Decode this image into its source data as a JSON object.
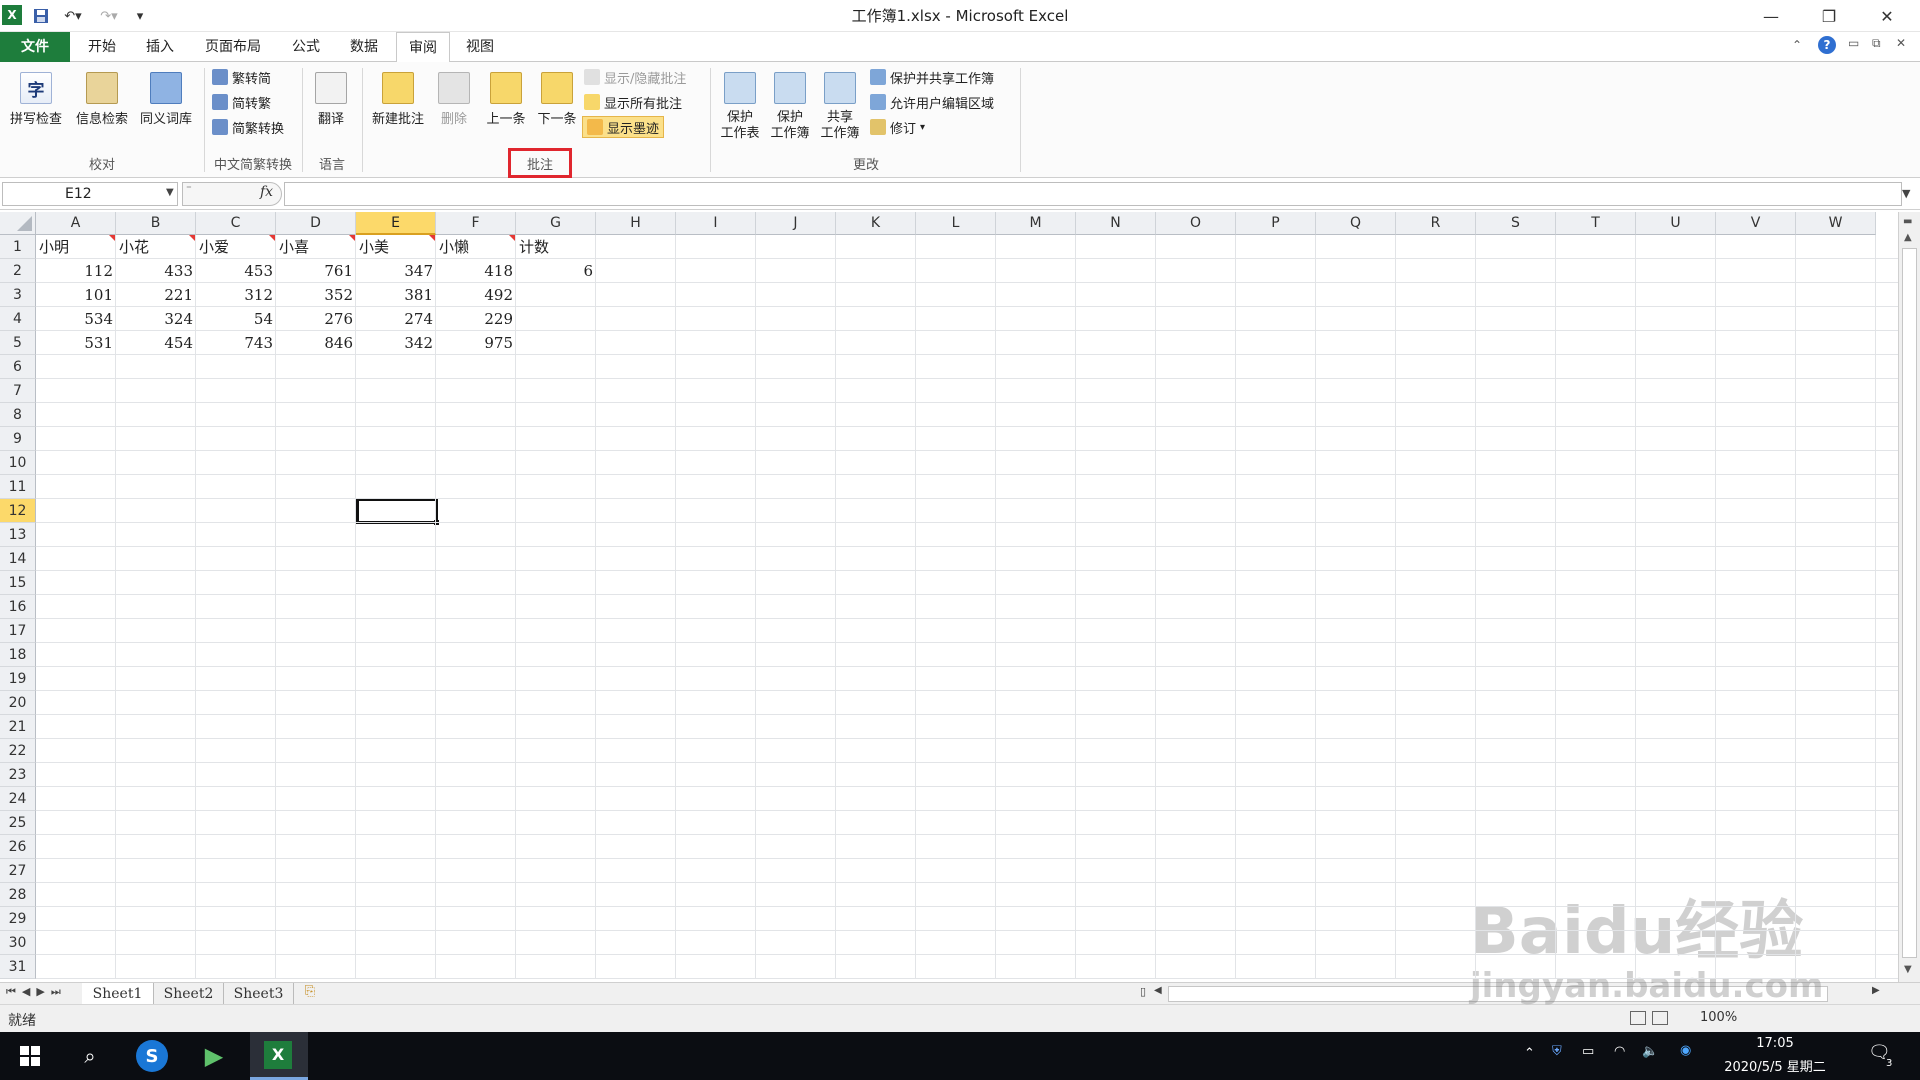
{
  "window": {
    "title": "工作簿1.xlsx - Microsoft Excel"
  },
  "quick_access": {
    "dropdown": "▾"
  },
  "tabs": [
    {
      "label": "文件"
    },
    {
      "label": "开始"
    },
    {
      "label": "插入"
    },
    {
      "label": "页面布局"
    },
    {
      "label": "公式"
    },
    {
      "label": "数据"
    },
    {
      "label": "审阅"
    },
    {
      "label": "视图"
    }
  ],
  "ribbon": {
    "proofing": {
      "spell": "拼写检查",
      "research": "信息检索",
      "thesaurus": "同义词库",
      "group": "校对"
    },
    "chinese": {
      "t2s": "繁转简",
      "s2t": "简转繁",
      "convert": "简繁转换",
      "group": "中文简繁转换"
    },
    "language": {
      "translate": "翻译",
      "group": "语言"
    },
    "comments": {
      "new": "新建批注",
      "delete": "删除",
      "prev": "上一条",
      "next": "下一条",
      "show_hide": "显示/隐藏批注",
      "show_all": "显示所有批注",
      "show_ink": "显示墨迹",
      "group": "批注"
    },
    "changes": {
      "protect_sheet_1": "保护",
      "protect_sheet_2": "工作表",
      "protect_book_1": "保护",
      "protect_book_2": "工作簿",
      "share_book_1": "共享",
      "share_book_2": "工作簿",
      "protect_share": "保护并共享工作簿",
      "allow_edit": "允许用户编辑区域",
      "track": "修订",
      "group": "更改"
    }
  },
  "formula_bar": {
    "name_box": "E12",
    "fx": "fx",
    "content": ""
  },
  "grid": {
    "columns": [
      "A",
      "B",
      "C",
      "D",
      "E",
      "F",
      "G",
      "H",
      "I",
      "J",
      "K",
      "L",
      "M",
      "N",
      "O",
      "P",
      "Q",
      "R",
      "S",
      "T",
      "U",
      "V",
      "W"
    ],
    "selected_column": "E",
    "rows": [
      "1",
      "2",
      "3",
      "4",
      "5",
      "6",
      "7",
      "8",
      "9",
      "10",
      "11",
      "12",
      "13",
      "14",
      "15",
      "16",
      "17",
      "18",
      "19",
      "20",
      "21",
      "22",
      "23",
      "24",
      "25",
      "26",
      "27",
      "28",
      "29",
      "30",
      "31"
    ],
    "selected_row": "12",
    "headers": [
      "小明",
      "小花",
      "小爱",
      "小喜",
      "小美",
      "小懒",
      "计数"
    ],
    "data": [
      [
        "112",
        "433",
        "453",
        "761",
        "347",
        "418",
        "6"
      ],
      [
        "101",
        "221",
        "312",
        "352",
        "381",
        "492",
        ""
      ],
      [
        "534",
        "324",
        "54",
        "276",
        "274",
        "229",
        ""
      ],
      [
        "531",
        "454",
        "743",
        "846",
        "342",
        "975",
        ""
      ]
    ]
  },
  "sheets": [
    {
      "label": "Sheet1"
    },
    {
      "label": "Sheet2"
    },
    {
      "label": "Sheet3"
    }
  ],
  "status": {
    "ready": "就绪",
    "zoom": "100%"
  },
  "taskbar": {
    "time": "17:05",
    "date": "2020/5/5 星期二",
    "notif_count": "3"
  },
  "watermark": {
    "brand": "Baidu经验",
    "url": "jingyan.baidu.com"
  },
  "colors": {
    "file_tab": "#1e7d3c",
    "highlight": "#fcd96a",
    "red_box": "#e0262e"
  }
}
